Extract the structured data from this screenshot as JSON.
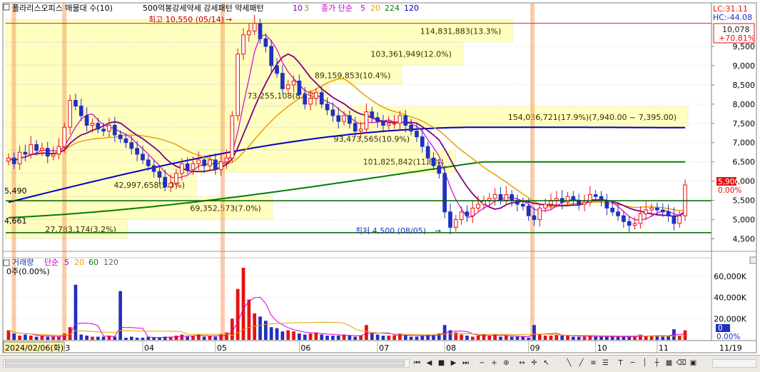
{
  "header": {
    "stock_name": "폴라리스오피스 매물대 수(10)",
    "indicator_label": "500억봉강세약세 강세패턴 약세패턴",
    "ma_title": "종가 단순",
    "ma_periods": [
      "10",
      "3",
      "5",
      "20",
      "224",
      "120"
    ],
    "lc": "LC:31.11",
    "hc": "HC:-44.08"
  },
  "price_box": {
    "price": "10,078",
    "change": "+70.81%"
  },
  "current": {
    "price": "5,900",
    "change": "0.00%"
  },
  "annotations": {
    "high": "최고 10,550 (05/14)",
    "low": "최저 4,500 (08/05)",
    "line_5490": "5,490",
    "line_4661": "4,661"
  },
  "volume_panel": {
    "title": "거래량",
    "ma_label": "단순",
    "ma_periods": [
      "5",
      "20",
      "60",
      "120"
    ],
    "first_value": "0주(0.00%)",
    "current_value": "0",
    "current_pct": "0.00%"
  },
  "footer": {
    "start_date": "2024/02/06(화)",
    "end_date": "11/19"
  },
  "colors": {
    "ma5": "#d000d0",
    "ma10": "#800080",
    "ma20": "#e8a000",
    "ma120": "#0000c0",
    "ma224": "#008000",
    "up": "#e81010",
    "down": "#2030c0",
    "volume_profile": "#ffffc0"
  },
  "chart_data": {
    "type": "candlestick",
    "y_axis": {
      "min": 4250,
      "max": 10000,
      "ticks": [
        "4,500",
        "5,000",
        "5,500",
        "6,000",
        "6,500",
        "7,000",
        "7,500",
        "8,000",
        "8,500",
        "9,000",
        "9,500"
      ]
    },
    "volume_axis": {
      "ticks": [
        "20,000K",
        "40,000K",
        "60,000K"
      ]
    },
    "x_ticks": [
      "03",
      "04",
      "05",
      "06",
      "07",
      "08",
      "09",
      "10",
      "11"
    ],
    "volume_profile": [
      {
        "label": "27,783,174(3.2%)",
        "price_low": 4500,
        "price_high": 5000
      },
      {
        "label": "69,352,573(7.0%)",
        "price_low": 5000,
        "price_high": 5600
      },
      {
        "label": "42,997,658(5.0%)",
        "price_low": 5600,
        "price_high": 6200
      },
      {
        "label": "101,825,842(11.8%)",
        "price_low": 6200,
        "price_high": 6800
      },
      {
        "label": "93,473,565(10.9%)",
        "price_low": 6800,
        "price_high": 7395
      },
      {
        "label": "154,036,721(17.9%)(7,940.00 ~ 7,395.00)",
        "price_low": 7395,
        "price_high": 7940
      },
      {
        "label": "73,255,108(8.5%)",
        "price_low": 7940,
        "price_high": 8500
      },
      {
        "label": "89,159,853(10.4%)",
        "price_low": 8500,
        "price_high": 9000
      },
      {
        "label": "103,361,949(12.0%)",
        "price_low": 9000,
        "price_high": 9600
      },
      {
        "label": "114,831,883(13.3%)",
        "price_low": 9600,
        "price_high": 10200
      }
    ],
    "hlines": [
      5490,
      4661
    ],
    "high_line": 10100,
    "closes": [
      6600,
      6450,
      6750,
      6700,
      6950,
      6800,
      6850,
      6650,
      6700,
      6900,
      7400,
      8100,
      7950,
      7700,
      7450,
      7500,
      7350,
      7300,
      7450,
      7200,
      7100,
      7000,
      6850,
      6700,
      6550,
      6400,
      6250,
      6100,
      5850,
      5950,
      6200,
      6450,
      6300,
      6450,
      6550,
      6400,
      6550,
      6300,
      6500,
      6600,
      7700,
      9300,
      9800,
      9900,
      10100,
      9700,
      9500,
      9000,
      8800,
      8400,
      8500,
      8600,
      8250,
      8000,
      8150,
      8300,
      8000,
      7850,
      7700,
      7550,
      7700,
      7500,
      7300,
      7350,
      7800,
      7650,
      7550,
      7450,
      7500,
      7500,
      7700,
      7450,
      7300,
      7150,
      6900,
      6600,
      6400,
      6200,
      5200,
      4800,
      5000,
      5200,
      5100,
      5300,
      5400,
      5500,
      5550,
      5650,
      5500,
      5650,
      5500,
      5400,
      5350,
      5100,
      5000,
      5300,
      5400,
      5500,
      5550,
      5450,
      5600,
      5500,
      5400,
      5450,
      5650,
      5600,
      5500,
      5300,
      5200,
      5100,
      4950,
      4850,
      4900,
      5150,
      5250,
      5300,
      5250,
      5200,
      5100,
      4900,
      5100,
      5900
    ],
    "volumes": [
      9,
      6,
      4,
      5,
      4,
      3,
      4,
      3,
      3,
      3,
      6,
      12,
      7,
      5,
      4,
      3,
      3,
      3,
      4,
      3,
      2,
      2,
      3,
      2,
      2,
      3,
      2,
      2,
      3,
      3,
      4,
      5,
      3,
      4,
      5,
      3,
      4,
      3,
      5,
      7,
      20,
      48,
      68,
      38,
      25,
      22,
      18,
      12,
      11,
      8,
      9,
      8,
      6,
      5,
      6,
      7,
      5,
      4,
      4,
      4,
      5,
      4,
      3,
      4,
      14,
      6,
      5,
      4,
      4,
      4,
      6,
      4,
      3,
      3,
      4,
      5,
      5,
      6,
      14,
      9,
      7,
      5,
      4,
      3,
      4,
      5,
      4,
      5,
      3,
      4,
      3,
      3,
      3,
      2,
      14,
      5,
      4,
      4,
      5,
      4,
      4,
      3,
      3,
      3,
      4,
      3,
      3,
      3,
      3,
      3,
      3,
      3,
      3,
      5,
      4,
      4,
      4,
      3,
      4,
      10,
      4,
      9
    ],
    "volume_spikes": [
      {
        "index": 12,
        "value": 52
      },
      {
        "index": 20,
        "value": 46
      }
    ]
  }
}
